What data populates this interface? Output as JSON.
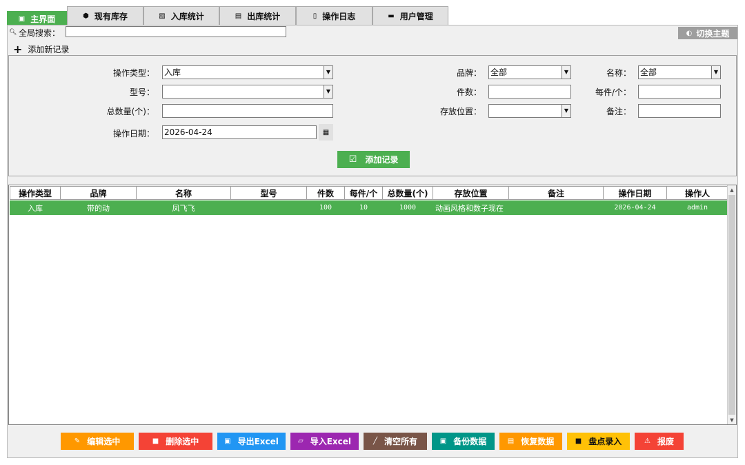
{
  "tabs": [
    {
      "icon": "home-icon",
      "glyph": "▣",
      "label": "主界面"
    },
    {
      "icon": "box-icon",
      "glyph": "⬢",
      "label": "现有库存"
    },
    {
      "icon": "chart-icon",
      "glyph": "▨",
      "label": "入库统计"
    },
    {
      "icon": "chart-out-icon",
      "glyph": "▤",
      "label": "出库统计"
    },
    {
      "icon": "log-icon",
      "glyph": "▯",
      "label": "操作日志"
    },
    {
      "icon": "users-icon",
      "glyph": "▬",
      "label": "用户管理"
    }
  ],
  "search": {
    "label": "全局搜索：",
    "value": ""
  },
  "theme_button": {
    "label": "切换主题"
  },
  "add_section": {
    "title": "添加新记录"
  },
  "form": {
    "op_type": {
      "label": "操作类型：",
      "value": "入库"
    },
    "model": {
      "label": "型号：",
      "value": ""
    },
    "total": {
      "label": "总数量(个)：",
      "value": ""
    },
    "date": {
      "label": "操作日期：",
      "value": "2026-04-24"
    },
    "brand": {
      "label": "品牌：",
      "value": "全部"
    },
    "pieces": {
      "label": "件数：",
      "value": ""
    },
    "location": {
      "label": "存放位置：",
      "value": ""
    },
    "name": {
      "label": "名称：",
      "value": "全部"
    },
    "per_piece": {
      "label": "每件/个：",
      "value": ""
    },
    "remark": {
      "label": "备注：",
      "value": ""
    },
    "submit_label": "添加记录"
  },
  "table": {
    "columns": [
      "操作类型",
      "品牌",
      "名称",
      "型号",
      "件数",
      "每件/个",
      "总数量(个)",
      "存放位置",
      "备注",
      "操作日期",
      "操作人"
    ],
    "rows": [
      [
        "入库",
        "带的动",
        "凤飞飞",
        "",
        "100",
        "10",
        "1000",
        "动画风格和数子现在",
        "",
        "2026-04-24",
        "admin"
      ]
    ]
  },
  "actions": [
    {
      "name": "edit-selected-button",
      "icon": "pencil-icon",
      "glyph": "✎",
      "label": "编辑选中",
      "color": "#ff9800"
    },
    {
      "name": "delete-selected-button",
      "icon": "trash-icon",
      "glyph": "■",
      "label": "删除选中",
      "color": "#f44336"
    },
    {
      "name": "export-excel-button",
      "icon": "save-icon",
      "glyph": "▣",
      "label": "导出Excel",
      "color": "#2196f3"
    },
    {
      "name": "import-excel-button",
      "icon": "folder-icon",
      "glyph": "▱",
      "label": "导入Excel",
      "color": "#9c27b0"
    },
    {
      "name": "clear-all-button",
      "icon": "broom-icon",
      "glyph": "╱",
      "label": "清空所有",
      "color": "#795548"
    },
    {
      "name": "backup-data-button",
      "icon": "disk-icon",
      "glyph": "▣",
      "label": "备份数据",
      "color": "#009688"
    },
    {
      "name": "restore-data-button",
      "icon": "file-icon",
      "glyph": "▤",
      "label": "恢复数据",
      "color": "#ff9800"
    },
    {
      "name": "inventory-entry-button",
      "icon": "box-icon",
      "glyph": "■",
      "label": "盘点录入",
      "color": "#ffc107"
    },
    {
      "name": "alert-button",
      "icon": "warning-icon",
      "glyph": "⚠",
      "label": "报废",
      "color": "#f44336"
    }
  ],
  "colors": {
    "accent": "#4caf50",
    "theme_button": "#9e9e9e"
  }
}
